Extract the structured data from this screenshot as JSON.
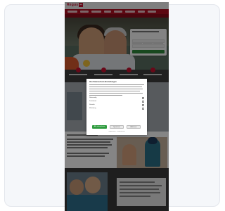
{
  "site": {
    "logo_text": "Regus",
    "logo_badge": "▪▪"
  },
  "cookie_dialog": {
    "title": "Ihre Datenschutz-Einstellungen",
    "options": [
      {
        "label": "Notwendig"
      },
      {
        "label": "Funktional"
      },
      {
        "label": "Statistik"
      },
      {
        "label": "Marketing"
      }
    ],
    "accept_label": "Alle akzeptieren",
    "save_label": "Speichern",
    "reject_label": "Ablehnen",
    "footer_links": "Impressum · Datenschutz"
  },
  "colors": {
    "brand_red": "#c8102e",
    "accept_green": "#2e9b3e"
  }
}
